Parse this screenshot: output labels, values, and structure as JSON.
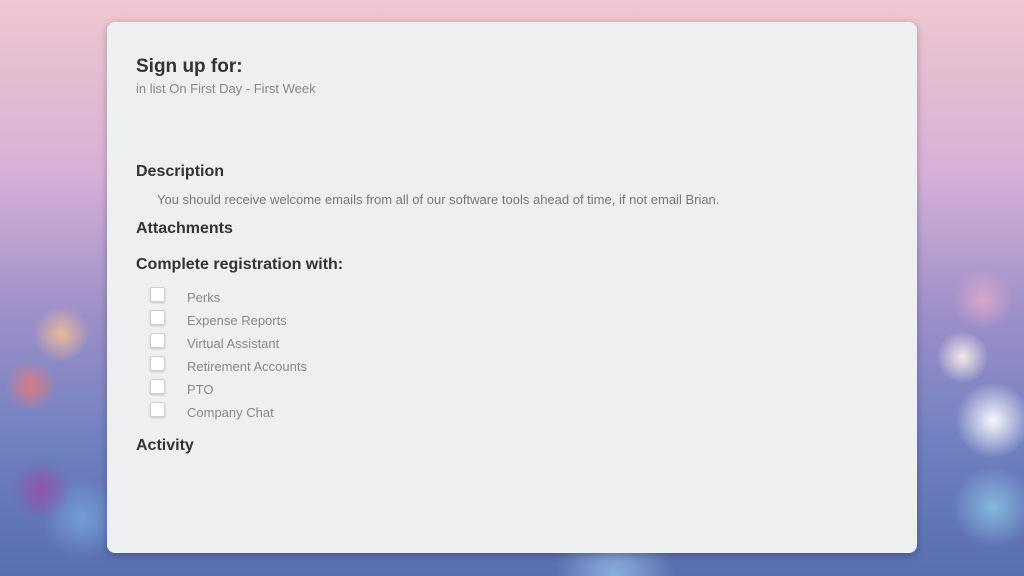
{
  "card": {
    "title": "Sign up for:",
    "subtitle": "in list On First Day - First Week"
  },
  "description": {
    "heading": "Description",
    "text": "You should receive welcome emails from all of our software tools ahead of time, if not email Brian."
  },
  "attachments": {
    "heading": "Attachments"
  },
  "registration": {
    "heading": "Complete registration with:",
    "items": [
      {
        "label": "Perks",
        "checked": false
      },
      {
        "label": "Expense Reports",
        "checked": false
      },
      {
        "label": "Virtual Assistant",
        "checked": false
      },
      {
        "label": "Retirement Accounts",
        "checked": false
      },
      {
        "label": "PTO",
        "checked": false
      },
      {
        "label": "Company Chat",
        "checked": false
      }
    ]
  },
  "activity": {
    "heading": "Activity"
  }
}
